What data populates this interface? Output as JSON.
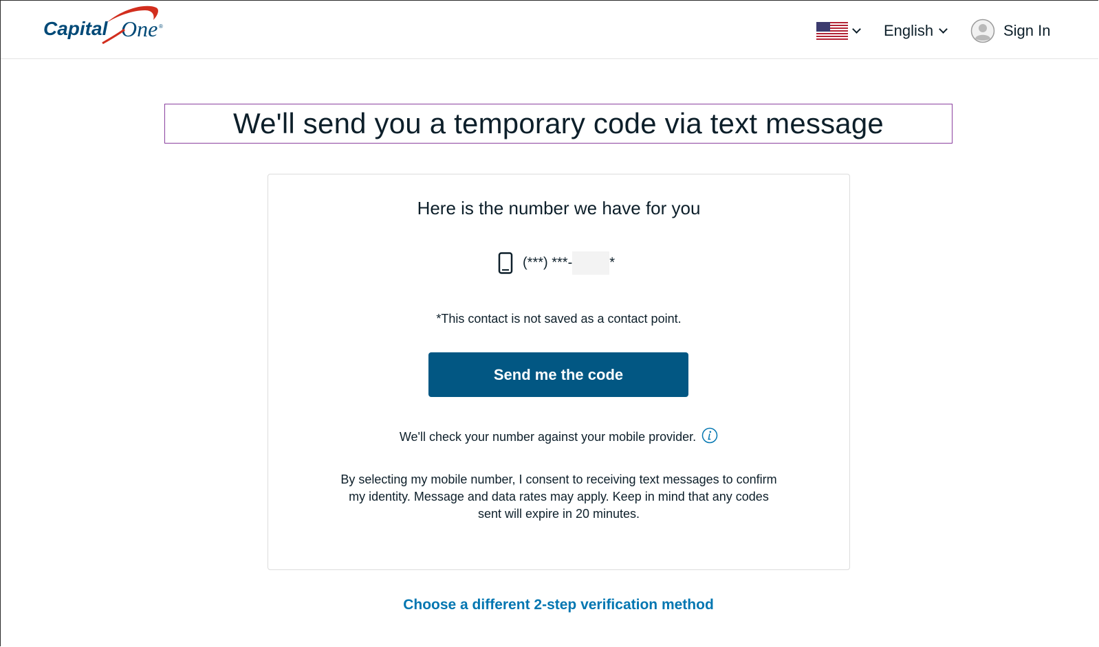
{
  "header": {
    "logo_text": "Capital One",
    "country_flag": "us-flag-icon",
    "language_label": "English",
    "signin_label": "Sign In"
  },
  "main": {
    "title": "We'll send you a temporary code via text message",
    "card": {
      "heading": "Here is the number we have for you",
      "phone_prefix": "(***) ***-",
      "phone_suffix": "*",
      "contact_note": "*This contact is not saved as a contact point.",
      "send_button_label": "Send me the code",
      "check_text": "We'll check your number against your mobile provider.",
      "consent_text": "By selecting my mobile number, I consent to receiving text messages to confirm my identity. Message and data rates may apply. Keep in mind that any codes sent will expire in 20 minutes."
    },
    "alt_link_label": "Choose a different 2-step verification method"
  },
  "colors": {
    "primary_button": "#025783",
    "link": "#0276b1",
    "title_border": "#8a3f9e",
    "brand_red": "#d22e1e",
    "brand_navy": "#004977"
  }
}
